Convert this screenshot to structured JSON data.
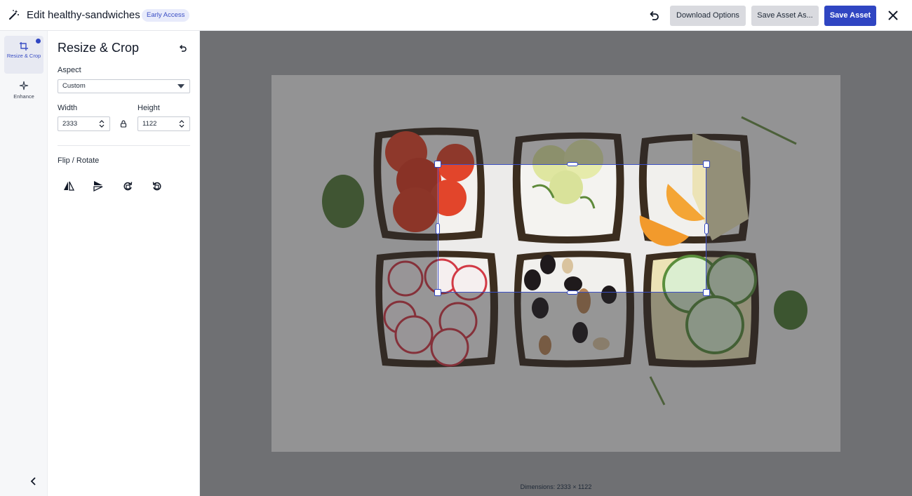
{
  "header": {
    "title": "Edit healthy-sandwiches",
    "badge": "Early Access",
    "download_label": "Download Options",
    "save_as_label": "Save Asset As...",
    "save_label": "Save Asset",
    "icons": [
      "magic-wand-icon",
      "undo-icon",
      "close-icon"
    ],
    "accent_color": "#2f45c2"
  },
  "rail": {
    "items": [
      {
        "label": "Resize & Crop",
        "icon": "crop-resize-icon",
        "active": true,
        "has_indicator": true
      },
      {
        "label": "Enhance",
        "icon": "sparkle-icon",
        "active": false
      }
    ],
    "collapse_icon": "chevron-left-icon"
  },
  "panel": {
    "title": "Resize & Crop",
    "aspect": {
      "label": "Aspect",
      "value": "Custom"
    },
    "width": {
      "label": "Width",
      "value": "2333"
    },
    "height": {
      "label": "Height",
      "value": "1122"
    },
    "flip_rotate": {
      "label": "Flip / Rotate",
      "tools": [
        "flip-horizontal-icon",
        "flip-vertical-icon",
        "rotate-clockwise-icon",
        "rotate-counterclockwise-icon"
      ]
    }
  },
  "canvas": {
    "image_subject": "six open-faced sandwiches on rye bread with cream cheese: tomato, lime, orange and cheese, radish, nuts and raisins, cucumber",
    "dimensions": "Dimensions: 2333 × 1122"
  }
}
